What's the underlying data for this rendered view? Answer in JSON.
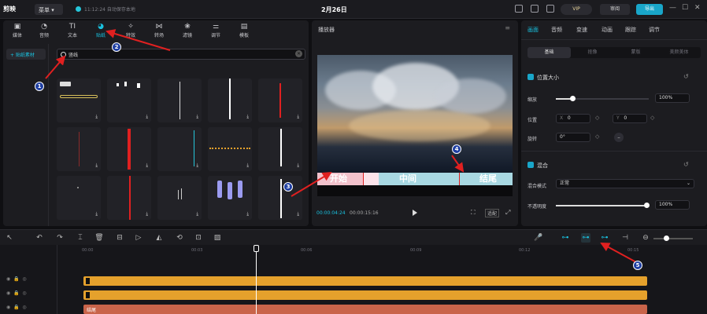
{
  "titlebar": {
    "logo": "剪映",
    "menu_label": "菜单",
    "autosave": "11:12:24 自动保存本地",
    "project_title": "2月26日",
    "vip_label": "VIP",
    "feedback_label": "审阅",
    "export_label": "导出"
  },
  "left_tabs": [
    {
      "label": "媒体",
      "icon": "media-icon"
    },
    {
      "label": "音频",
      "icon": "audio-icon"
    },
    {
      "label": "文本",
      "icon": "text-icon"
    },
    {
      "label": "贴纸",
      "icon": "sticker-icon"
    },
    {
      "label": "特效",
      "icon": "effects-icon"
    },
    {
      "label": "转场",
      "icon": "transition-icon"
    },
    {
      "label": "滤镜",
      "icon": "filter-icon"
    },
    {
      "label": "调节",
      "icon": "adjust-icon"
    },
    {
      "label": "模板",
      "icon": "template-icon"
    }
  ],
  "sidebar": {
    "category": "+ 贴纸素材"
  },
  "search": {
    "query": "竖线"
  },
  "player": {
    "title": "播放器",
    "captions": [
      "开始",
      "中间",
      "结尾"
    ],
    "time_current": "00:00:04:24",
    "time_total": "00:00:15:16",
    "ratio_label": "适配"
  },
  "right_tabs": [
    "画面",
    "音频",
    "变速",
    "动画",
    "跟踪",
    "调节"
  ],
  "right_subtabs": [
    "基础",
    "抠像",
    "蒙版",
    "美颜美体"
  ],
  "props": {
    "position_size": "位置大小",
    "scale_label": "缩放",
    "scale_value": "100%",
    "scale_level": 0.2,
    "position_label": "位置",
    "pos_x_label": "X",
    "pos_x": "0",
    "pos_y_label": "Y",
    "pos_y": "0",
    "rotate_label": "旋转",
    "rotate_value": "0°",
    "blend_section": "混合",
    "blend_mode_label": "混合模式",
    "blend_mode_value": "正常",
    "opacity_label": "不透明度",
    "opacity_value": "100%",
    "opacity_level": 1.0
  },
  "timeline": {
    "ruler": [
      "00:00",
      "00:03",
      "00:06",
      "00:09",
      "00:12",
      "00:15"
    ],
    "track3_label": "结尾"
  },
  "annotations": [
    "1",
    "2",
    "3",
    "4",
    "5"
  ],
  "colors": {
    "accent": "#19c2e0",
    "sticker_track": "#e5a12c",
    "text_track": "#c9644a",
    "arrow": "#e02020"
  }
}
